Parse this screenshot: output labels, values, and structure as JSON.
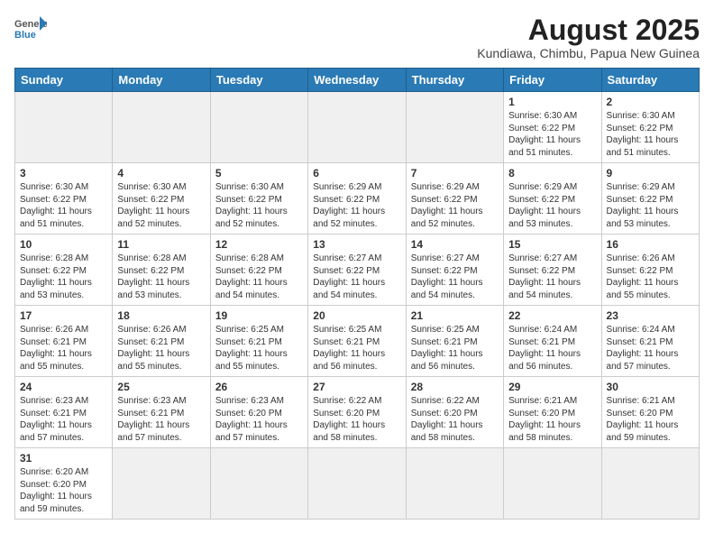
{
  "header": {
    "logo_general": "General",
    "logo_blue": "Blue",
    "title": "August 2025",
    "subtitle": "Kundiawa, Chimbu, Papua New Guinea"
  },
  "weekdays": [
    "Sunday",
    "Monday",
    "Tuesday",
    "Wednesday",
    "Thursday",
    "Friday",
    "Saturday"
  ],
  "weeks": [
    [
      {
        "day": "",
        "info": "",
        "empty": true
      },
      {
        "day": "",
        "info": "",
        "empty": true
      },
      {
        "day": "",
        "info": "",
        "empty": true
      },
      {
        "day": "",
        "info": "",
        "empty": true
      },
      {
        "day": "",
        "info": "",
        "empty": true
      },
      {
        "day": "1",
        "info": "Sunrise: 6:30 AM\nSunset: 6:22 PM\nDaylight: 11 hours and 51 minutes."
      },
      {
        "day": "2",
        "info": "Sunrise: 6:30 AM\nSunset: 6:22 PM\nDaylight: 11 hours and 51 minutes."
      }
    ],
    [
      {
        "day": "3",
        "info": "Sunrise: 6:30 AM\nSunset: 6:22 PM\nDaylight: 11 hours and 51 minutes."
      },
      {
        "day": "4",
        "info": "Sunrise: 6:30 AM\nSunset: 6:22 PM\nDaylight: 11 hours and 52 minutes."
      },
      {
        "day": "5",
        "info": "Sunrise: 6:30 AM\nSunset: 6:22 PM\nDaylight: 11 hours and 52 minutes."
      },
      {
        "day": "6",
        "info": "Sunrise: 6:29 AM\nSunset: 6:22 PM\nDaylight: 11 hours and 52 minutes."
      },
      {
        "day": "7",
        "info": "Sunrise: 6:29 AM\nSunset: 6:22 PM\nDaylight: 11 hours and 52 minutes."
      },
      {
        "day": "8",
        "info": "Sunrise: 6:29 AM\nSunset: 6:22 PM\nDaylight: 11 hours and 53 minutes."
      },
      {
        "day": "9",
        "info": "Sunrise: 6:29 AM\nSunset: 6:22 PM\nDaylight: 11 hours and 53 minutes."
      }
    ],
    [
      {
        "day": "10",
        "info": "Sunrise: 6:28 AM\nSunset: 6:22 PM\nDaylight: 11 hours and 53 minutes."
      },
      {
        "day": "11",
        "info": "Sunrise: 6:28 AM\nSunset: 6:22 PM\nDaylight: 11 hours and 53 minutes."
      },
      {
        "day": "12",
        "info": "Sunrise: 6:28 AM\nSunset: 6:22 PM\nDaylight: 11 hours and 54 minutes."
      },
      {
        "day": "13",
        "info": "Sunrise: 6:27 AM\nSunset: 6:22 PM\nDaylight: 11 hours and 54 minutes."
      },
      {
        "day": "14",
        "info": "Sunrise: 6:27 AM\nSunset: 6:22 PM\nDaylight: 11 hours and 54 minutes."
      },
      {
        "day": "15",
        "info": "Sunrise: 6:27 AM\nSunset: 6:22 PM\nDaylight: 11 hours and 54 minutes."
      },
      {
        "day": "16",
        "info": "Sunrise: 6:26 AM\nSunset: 6:22 PM\nDaylight: 11 hours and 55 minutes."
      }
    ],
    [
      {
        "day": "17",
        "info": "Sunrise: 6:26 AM\nSunset: 6:21 PM\nDaylight: 11 hours and 55 minutes."
      },
      {
        "day": "18",
        "info": "Sunrise: 6:26 AM\nSunset: 6:21 PM\nDaylight: 11 hours and 55 minutes."
      },
      {
        "day": "19",
        "info": "Sunrise: 6:25 AM\nSunset: 6:21 PM\nDaylight: 11 hours and 55 minutes."
      },
      {
        "day": "20",
        "info": "Sunrise: 6:25 AM\nSunset: 6:21 PM\nDaylight: 11 hours and 56 minutes."
      },
      {
        "day": "21",
        "info": "Sunrise: 6:25 AM\nSunset: 6:21 PM\nDaylight: 11 hours and 56 minutes."
      },
      {
        "day": "22",
        "info": "Sunrise: 6:24 AM\nSunset: 6:21 PM\nDaylight: 11 hours and 56 minutes."
      },
      {
        "day": "23",
        "info": "Sunrise: 6:24 AM\nSunset: 6:21 PM\nDaylight: 11 hours and 57 minutes."
      }
    ],
    [
      {
        "day": "24",
        "info": "Sunrise: 6:23 AM\nSunset: 6:21 PM\nDaylight: 11 hours and 57 minutes."
      },
      {
        "day": "25",
        "info": "Sunrise: 6:23 AM\nSunset: 6:21 PM\nDaylight: 11 hours and 57 minutes."
      },
      {
        "day": "26",
        "info": "Sunrise: 6:23 AM\nSunset: 6:20 PM\nDaylight: 11 hours and 57 minutes."
      },
      {
        "day": "27",
        "info": "Sunrise: 6:22 AM\nSunset: 6:20 PM\nDaylight: 11 hours and 58 minutes."
      },
      {
        "day": "28",
        "info": "Sunrise: 6:22 AM\nSunset: 6:20 PM\nDaylight: 11 hours and 58 minutes."
      },
      {
        "day": "29",
        "info": "Sunrise: 6:21 AM\nSunset: 6:20 PM\nDaylight: 11 hours and 58 minutes."
      },
      {
        "day": "30",
        "info": "Sunrise: 6:21 AM\nSunset: 6:20 PM\nDaylight: 11 hours and 59 minutes."
      }
    ],
    [
      {
        "day": "31",
        "info": "Sunrise: 6:20 AM\nSunset: 6:20 PM\nDaylight: 11 hours and 59 minutes."
      },
      {
        "day": "",
        "info": "",
        "empty": true
      },
      {
        "day": "",
        "info": "",
        "empty": true
      },
      {
        "day": "",
        "info": "",
        "empty": true
      },
      {
        "day": "",
        "info": "",
        "empty": true
      },
      {
        "day": "",
        "info": "",
        "empty": true
      },
      {
        "day": "",
        "info": "",
        "empty": true
      }
    ]
  ]
}
